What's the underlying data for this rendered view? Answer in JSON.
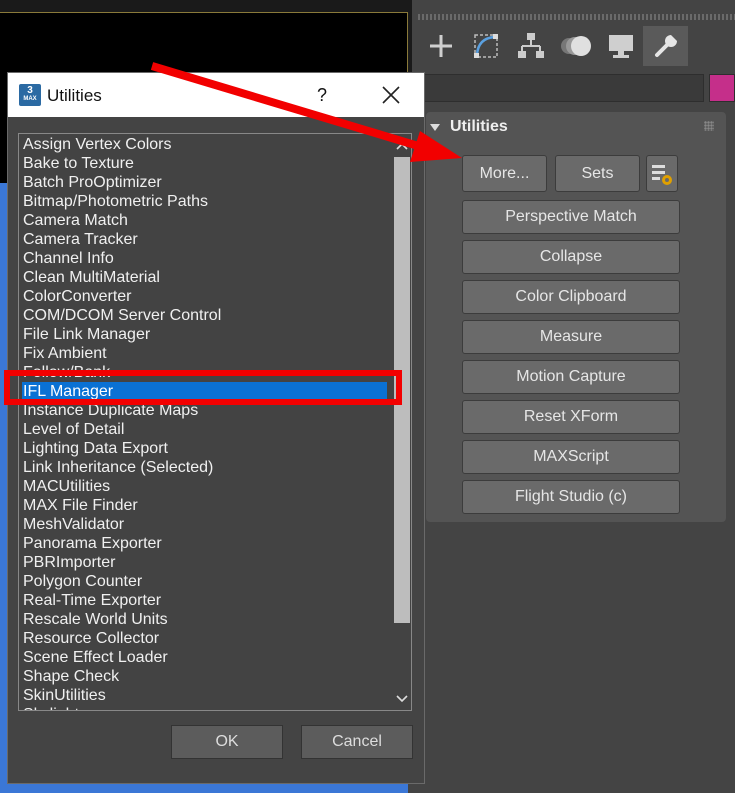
{
  "command_panel": {
    "tabs": [
      {
        "icon": "create-plus-icon"
      },
      {
        "icon": "modify-curve-icon"
      },
      {
        "icon": "hierarchy-icon"
      },
      {
        "icon": "motion-icon"
      },
      {
        "icon": "display-monitor-icon"
      },
      {
        "icon": "utilities-wrench-icon",
        "active": true
      }
    ],
    "object_color": "#c52f8a",
    "rollout": {
      "title": "Utilities",
      "more_label": "More...",
      "sets_label": "Sets",
      "configure_icon": "configure-sets-icon",
      "buttons": [
        "Perspective Match",
        "Collapse",
        "Color Clipboard",
        "Measure",
        "Motion Capture",
        "Reset XForm",
        "MAXScript",
        "Flight Studio (c)"
      ]
    }
  },
  "dialog": {
    "title": "Utilities",
    "app_icon": "3ds-max-icon",
    "help_label": "?",
    "items": [
      "Assign Vertex Colors",
      "Bake to Texture",
      "Batch ProOptimizer",
      "Bitmap/Photometric Paths",
      "Camera Match",
      "Camera Tracker",
      "Channel Info",
      "Clean MultiMaterial",
      "ColorConverter",
      "COM/DCOM Server Control",
      "File Link Manager",
      "Fix Ambient",
      "Follow/Bank",
      "IFL Manager",
      "Instance Duplicate Maps",
      "Level of Detail",
      "Lighting Data Export",
      "Link Inheritance (Selected)",
      "MACUtilities",
      "MAX File Finder",
      "MeshValidator",
      "Panorama Exporter",
      "PBRImporter",
      "Polygon Counter",
      "Real-Time Exporter",
      "Rescale World Units",
      "Resource Collector",
      "Scene Effect Loader",
      "Shape Check",
      "SkinUtilities",
      "Skylight"
    ],
    "selected_item": "IFL Manager",
    "ok_label": "OK",
    "cancel_label": "Cancel"
  },
  "annotation": {
    "color": "#f20000"
  }
}
